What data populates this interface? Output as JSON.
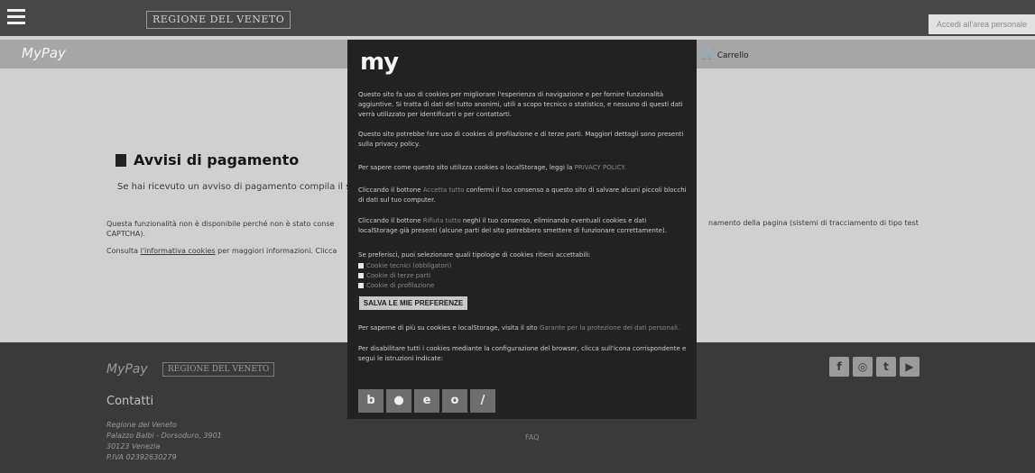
{
  "topbar": {
    "menu_icon": "hamburger-icon",
    "regione_logo": "REGIONE DEL VENETO",
    "area_button": "Accedi all'area personale"
  },
  "mypay_bar": {
    "logo": "MyPay",
    "cart_icon": "shopping-cart-icon",
    "cart_label": "Carrello"
  },
  "main": {
    "title": "Avvisi di pagamento",
    "title_icon": "document-icon",
    "subtitle": "Se hai ricevuto un avviso di pagamento compila il segu",
    "notice_left": "Questa funzionalità non è disponibile perché non è stato conse",
    "notice_left_2": "CAPTCHA).",
    "notice_right": "namento della pagina (sistemi di tracciamento di tipo test",
    "notice_link_prefix": "Consulta",
    "notice_link": "l'informativa cookies",
    "notice_link_suffix": "per maggiori informazioni. Clicca"
  },
  "footer": {
    "mypay_logo": "MyPay",
    "regione_logo": "REGIONE DEL VENETO",
    "contacts_title": "Contatti",
    "address": [
      "Regione del Veneto",
      "Palazzo Balbi - Dorsoduro, 3901",
      "30123 Venezia",
      "P.IVA 02392630279"
    ],
    "faq": "FAQ",
    "social": [
      {
        "icon": "facebook-icon",
        "glyph": "f"
      },
      {
        "icon": "instagram-icon",
        "glyph": "◎"
      },
      {
        "icon": "twitter-icon",
        "glyph": "t"
      },
      {
        "icon": "youtube-icon",
        "glyph": "▶"
      }
    ]
  },
  "cookie_modal": {
    "logo": "my",
    "p1": "Questo sito fa uso di cookies per migliorare l'esperienza di navigazione e per fornire funzionalità aggiuntive. Si tratta di dati del tutto anonimi, utili a scopo tecnico o statistico, e nessuno di questi dati verrà utilizzato per identificarti o per contattarti.",
    "p2": "Questo sito potrebbe fare uso di cookies di profilazione e di terze parti. Maggiori dettagli sono presenti sulla privacy policy.",
    "p3_prefix": "Per sapere come questo sito utilizza cookies o localStorage, leggi la",
    "p3_link": "PRIVACY POLICY.",
    "p4_prefix": "Cliccando il bottone",
    "p4_link": "Accetta tutto",
    "p4_suffix": "confermi il tuo consenso a questo sito di salvare alcuni piccoli blocchi di dati sul tuo computer.",
    "p5_prefix": "Cliccando il bottone",
    "p5_link": "Rifiuta tutto",
    "p5_suffix": "neghi il tuo consenso, eliminando eventuali cookies e dati localStorage già presenti (alcune parti del sito potrebbero smettere di funzionare correttamente).",
    "p6": "Se preferisci, puoi selezionare quali tipologie di cookies ritieni accettabili:",
    "options": [
      {
        "label": "Cookie tecnici (obbligatori)",
        "checked": true
      },
      {
        "label": "Cookie di terze parti",
        "checked": true
      },
      {
        "label": "Cookie di profilazione",
        "checked": false
      }
    ],
    "save_button": "SALVA LE MIE PREFERENZE",
    "p7_prefix": "Per saperne di più su cookies e localStorage, visita il sito",
    "p7_link": "Garante per la protezione dei dati personali.",
    "p8": "Per disabilitare tutti i cookies mediante la configurazione del browser, clicca sull'icona corrispondente e segui le istruzioni indicate:",
    "browsers": [
      {
        "icon": "chrome-icon",
        "glyph": "b"
      },
      {
        "icon": "firefox-icon",
        "glyph": "●"
      },
      {
        "icon": "ie-icon",
        "glyph": "e"
      },
      {
        "icon": "opera-icon",
        "glyph": "o"
      },
      {
        "icon": "safari-icon",
        "glyph": "/"
      }
    ]
  }
}
